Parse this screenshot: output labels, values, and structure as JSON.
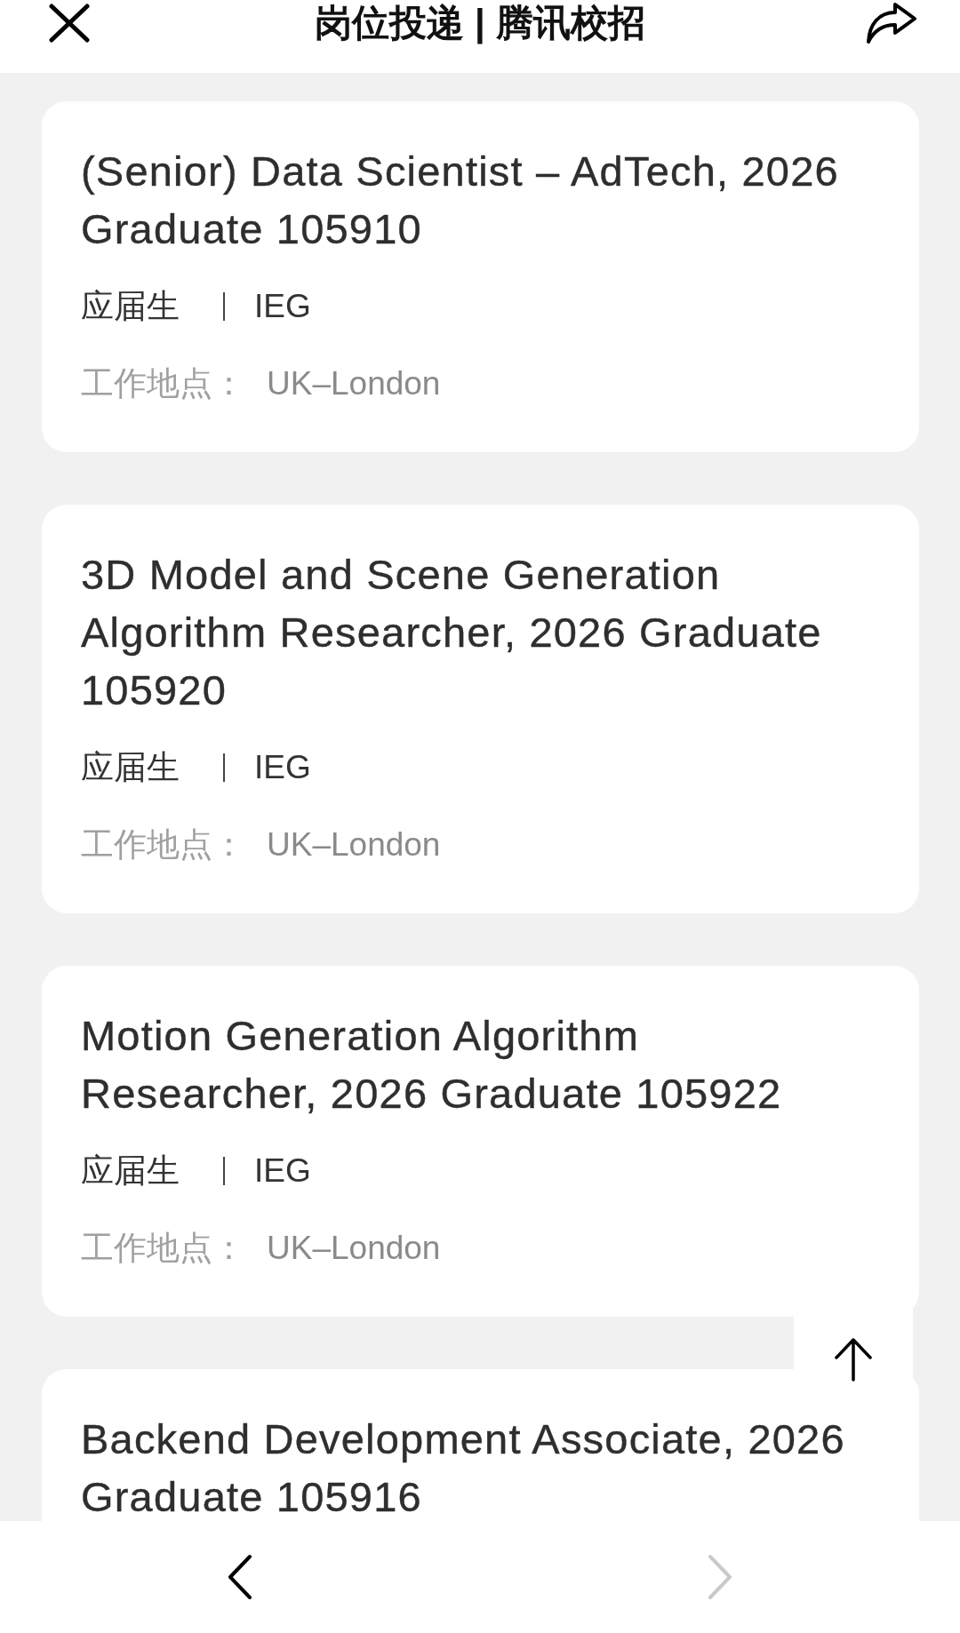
{
  "header": {
    "title": "岗位投递 | 腾讯校招"
  },
  "jobs": [
    {
      "title": "(Senior) Data Scientist – AdTech, 2026 Graduate 105910",
      "tags": [
        "应届生",
        "IEG"
      ],
      "location_label": "工作地点：",
      "location": "UK–London"
    },
    {
      "title": "3D Model and Scene Generation Algorithm Researcher, 2026 Graduate 105920",
      "tags": [
        "应届生",
        "IEG"
      ],
      "location_label": "工作地点：",
      "location": "UK–London"
    },
    {
      "title": "Motion Generation Algorithm Researcher, 2026 Graduate 105922",
      "tags": [
        "应届生",
        "IEG"
      ],
      "location_label": "工作地点：",
      "location": "UK–London"
    },
    {
      "title": "Backend Development Associate, 2026 Graduate 105916"
    }
  ],
  "toolbar": [
    {
      "kind": "back",
      "disabled": false
    },
    {
      "kind": "forward",
      "disabled": true
    }
  ]
}
